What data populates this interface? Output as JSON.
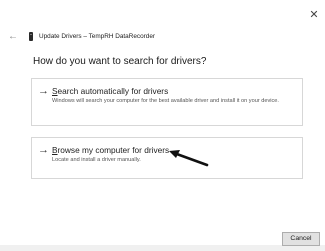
{
  "window": {
    "title": "Update Drivers – TempRH DataRecorder",
    "close_glyph": "✕",
    "back_glyph": "←"
  },
  "heading": "How do you want to search for drivers?",
  "options": [
    {
      "arrow": "→",
      "title_mnemonic": "S",
      "title_rest": "earch automatically for drivers",
      "description": "Windows will search your computer for the best available driver and install it on your device."
    },
    {
      "arrow": "→",
      "title_mnemonic": "B",
      "title_rest": "rowse my computer for drivers",
      "description": "Locate and install a driver manually."
    }
  ],
  "footer": {
    "cancel_label": "Cancel"
  },
  "icons": {
    "close": "close-icon",
    "back": "back-arrow-icon",
    "device": "usb-device-icon",
    "option_arrow": "right-arrow-icon",
    "annotation": "annotation-arrow-icon"
  }
}
